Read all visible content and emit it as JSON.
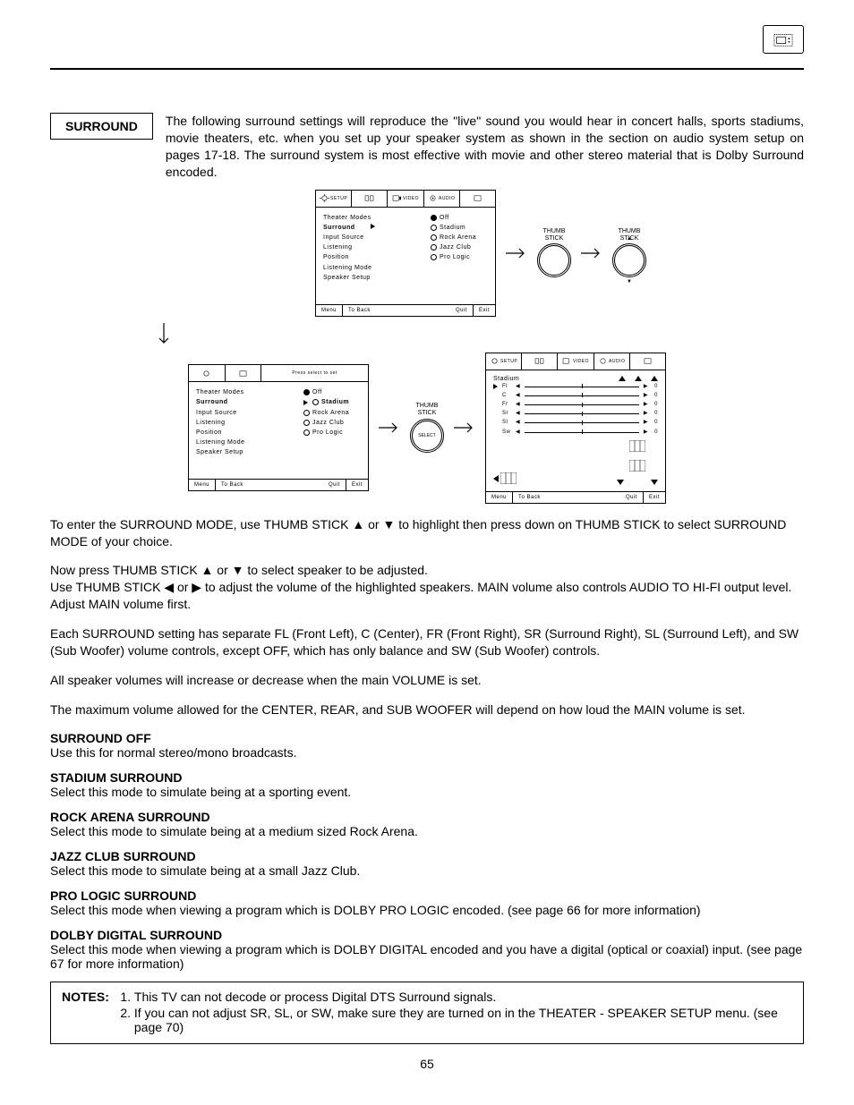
{
  "header": {
    "icon_name": "tv-icon"
  },
  "section": {
    "title": "SURROUND"
  },
  "intro": {
    "text": "The following surround settings will reproduce the \"live\" sound you would hear in concert halls, sports stadiums, movie theaters, etc. when you set up your speaker system as shown in the section on audio system setup on pages 17-18. The surround system is most effective with movie and other stereo material that is Dolby Surround encoded."
  },
  "osd_common": {
    "tabs": [
      "SETUP",
      "",
      "VIDEO",
      "AUDIO",
      ""
    ],
    "footer": {
      "menu": "Menu",
      "to_back": "To Back",
      "quit": "Quit",
      "exit": "Exit"
    }
  },
  "osd1": {
    "left_items": [
      "Theater Modes",
      "Surround",
      "Input Source",
      "Listening",
      "  Position",
      "Listening Mode",
      "Speaker Setup"
    ],
    "right_items": [
      "Off",
      "Stadium",
      "Rock Arena",
      "Jazz Club",
      "Pro Logic"
    ],
    "selected_index": 0,
    "highlighted_left": 1
  },
  "thumb": {
    "label": "THUMB\nSTICK",
    "select": "SELECT"
  },
  "osd2": {
    "press_label": "Press select to set",
    "left_items": [
      "Theater Modes",
      "Surround",
      "Input Source",
      "Listening",
      "  Position",
      "Listening Mode",
      "Speaker Setup"
    ],
    "right_items": [
      "Off",
      "Stadium",
      "Rock Arena",
      "Jazz Club",
      "Pro Logic"
    ],
    "selected_index": 0,
    "pointer_index": 1,
    "highlighted_left": 1
  },
  "osd3": {
    "title": "Stadium",
    "channels": [
      "Fl",
      "C",
      "Fr",
      "Sr",
      "Sl",
      "Sw"
    ],
    "values": [
      0,
      0,
      0,
      0,
      0,
      0
    ]
  },
  "body": {
    "p1": "To enter the SURROUND MODE, use THUMB STICK ▲ or ▼ to highlight then press down on THUMB STICK to select SURROUND MODE of your choice.",
    "p2": "Now press THUMB STICK ▲ or ▼ to select speaker to be adjusted.",
    "p3": "Use THUMB STICK ◀ or ▶ to adjust the volume of the highlighted speakers. MAIN volume also controls AUDIO TO HI-FI output level.  Adjust MAIN volume first.",
    "p4": "Each SURROUND setting has separate FL (Front Left), C (Center), FR (Front Right), SR (Surround Right), SL (Surround Left), and SW (Sub Woofer) volume controls, except OFF, which has only balance and SW (Sub Woofer) controls.",
    "p5": "All speaker volumes will increase or decrease when the main VOLUME is set.",
    "p6": "The maximum volume allowed for the CENTER, REAR, and SUB WOOFER will depend on how loud the MAIN volume is set."
  },
  "modes": [
    {
      "title": "SURROUND OFF",
      "desc": "Use this for normal stereo/mono broadcasts."
    },
    {
      "title": "STADIUM SURROUND",
      "desc": "Select this mode to simulate being at a sporting event."
    },
    {
      "title": "ROCK ARENA SURROUND",
      "desc": "Select this mode to simulate being at a medium sized Rock Arena."
    },
    {
      "title": "JAZZ CLUB SURROUND",
      "desc": "Select this mode to simulate being at a small Jazz Club."
    },
    {
      "title": "PRO LOGIC SURROUND",
      "desc": "Select this mode when viewing a program which is DOLBY PRO LOGIC encoded.  (see page 66 for more information)"
    },
    {
      "title": "DOLBY DIGITAL SURROUND",
      "desc": "Select this mode when viewing a program which is DOLBY DIGITAL encoded and you have a digital (optical or coaxial) input.  (see page 67 for more information)"
    }
  ],
  "notes": {
    "label": "NOTES:",
    "items": [
      "This TV can not decode or process Digital DTS Surround signals.",
      "If you can not adjust SR, SL, or SW, make sure they are turned on in the THEATER - SPEAKER SETUP menu. (see page 70)"
    ]
  },
  "page_number": "65"
}
